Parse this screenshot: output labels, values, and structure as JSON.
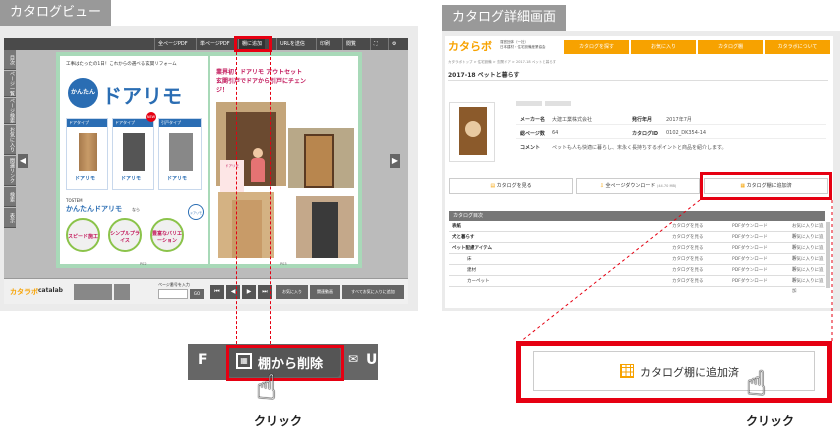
{
  "left_section": {
    "tab_title": "カタログビュー",
    "toolbar": {
      "all_pdf": "全ページPDF",
      "page_pdf": "単ページPDF",
      "shelf": "棚に追加",
      "url": "URLを送信",
      "print": "印刷",
      "search": "閲覧"
    },
    "sidebar_tabs": [
      "目次",
      "ページ一覧",
      "ページ検索",
      "お気に入り",
      "関連リンク",
      "検索",
      "表示"
    ],
    "catalog": {
      "tagline": "工事はたったの1日！これからの選べる玄関リフォーム",
      "brand_kantan": "かんたん",
      "brand_doarimo": "ドアリモ",
      "headline": "業界初！ドアリモ アウトセット玄関引戸でドアから引戸にチェンジ！",
      "card_labels": [
        "ドアタイプ",
        "ドアタイプ",
        "引戸タイプ"
      ],
      "card_logo": "ドアリモ",
      "new_badge": "NEW",
      "bottom_title_prefix": "TOSTEM",
      "bottom_title": "かんたんドアリモ",
      "bottom_suffix": "なら",
      "features": [
        "スピード施工",
        "シンプルプライス",
        "豊富なバリエーション"
      ],
      "door_badge": "ドアリモ",
      "door_label": "ドアリモ",
      "page_num_left": "P02",
      "page_num_right": "P03"
    },
    "bottom_bar": {
      "logo_a": "カタラボ",
      "logo_b": "catalab",
      "page_input_label": "ページ番号を入力",
      "go": "GO",
      "fav": "お気に入り",
      "related": "関連動画",
      "add_all": "すべてお気に入りに追加"
    },
    "zoom": {
      "left_fragment": "F",
      "shelf_remove": "棚から削除",
      "right_fragment": "U"
    },
    "click_label": "クリック"
  },
  "right_section": {
    "tab_title": "カタログ詳細画面",
    "logo": "カタらボ",
    "logo_sub_1": "運営団体（一社）",
    "logo_sub_2": "日本建材・住宅設備産業協会",
    "nav": [
      "カタログを探す",
      "お気に入り",
      "カタログ棚",
      "カタラボについて"
    ],
    "breadcrumb": "カタラボトップ > 住宅設備 > 玄関ドア > 2017-18 ペットと暮らす",
    "page_title": "2017-18 ペットと暮らす",
    "meta": {
      "maker_label": "メーカー名",
      "maker_value": "大建工業株式会社",
      "date_label": "発行年月",
      "date_value": "2017年7月",
      "pages_label": "総ページ数",
      "pages_value": "64",
      "id_label": "カタログID",
      "id_value": "0102_DK354-14",
      "comment_label": "コメント",
      "comment_value": "ペットも人も快適に暮らし、末永く長持ちするポイントと商品を紹介します。"
    },
    "actions": {
      "view": "カタログを見る",
      "download": "全ページダウンロード",
      "download_size": "(44.70 MB)",
      "shelf_added": "カタログ棚に追加済"
    },
    "toc_title": "カタログ目次",
    "toc_rows": [
      {
        "name": "表紙",
        "indent": false
      },
      {
        "name": "犬と暮らす",
        "indent": false
      },
      {
        "name": "ペット配慮アイテム",
        "indent": false
      },
      {
        "name": "床",
        "indent": true
      },
      {
        "name": "建材",
        "indent": true
      },
      {
        "name": "カーペット",
        "indent": true
      }
    ],
    "toc_actions": {
      "view": "カタログを見る",
      "pdf": "PDFダウンロード",
      "fav": "お気に入りに追加"
    },
    "zoom_label": "カタログ棚に追加済",
    "click_label": "クリック"
  }
}
